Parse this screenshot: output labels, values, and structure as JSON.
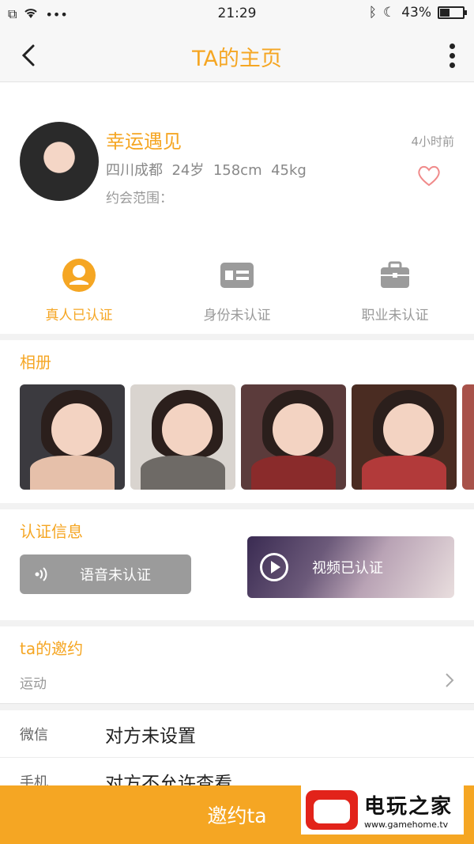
{
  "status_bar": {
    "time": "21:29",
    "battery_text": "43%",
    "battery_level": 0.43
  },
  "nav": {
    "title": "TA的主页"
  },
  "profile": {
    "name": "幸运遇见",
    "location": "四川成都",
    "age": "24岁",
    "height": "158cm",
    "weight": "45kg",
    "date_range_label": "约会范围：",
    "last_active": "4小时前"
  },
  "verifications": [
    {
      "label": "真人已认证",
      "icon": "person-icon",
      "active": true
    },
    {
      "label": "身份未认证",
      "icon": "id-card-icon",
      "active": false
    },
    {
      "label": "职业未认证",
      "icon": "briefcase-icon",
      "active": false
    }
  ],
  "album": {
    "title": "相册"
  },
  "certification": {
    "title": "认证信息",
    "voice_label": "语音未认证",
    "video_label": "视频已认证"
  },
  "invite": {
    "title": "ta的邀约",
    "item": "运动"
  },
  "contact": [
    {
      "key": "微信",
      "value": "对方未设置"
    },
    {
      "key": "手机",
      "value": "对方不允许查看"
    }
  ],
  "bottom": {
    "button_label": "邀约ta"
  },
  "watermark": {
    "text": "电玩之家",
    "url": "www.gamehome.tv"
  },
  "colors": {
    "accent": "#f5a623",
    "grey_button": "#9b9b9b"
  }
}
